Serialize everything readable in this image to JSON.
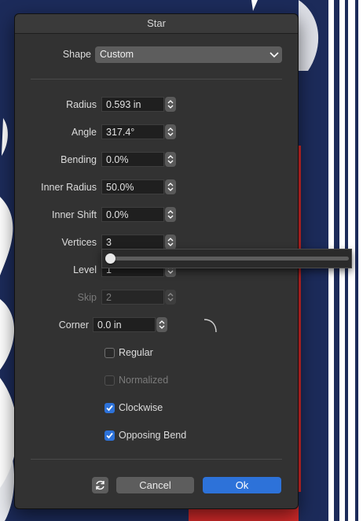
{
  "window": {
    "title": "Star"
  },
  "shape": {
    "label": "Shape",
    "value": "Custom"
  },
  "fields": {
    "radius": {
      "label": "Radius",
      "value": "0.593 in"
    },
    "angle": {
      "label": "Angle",
      "value": "317.4°"
    },
    "bending": {
      "label": "Bending",
      "value": "0.0%"
    },
    "inner_radius": {
      "label": "Inner Radius",
      "value": "50.0%"
    },
    "inner_shift": {
      "label": "Inner Shift",
      "value": "0.0%"
    },
    "vertices": {
      "label": "Vertices",
      "value": "3"
    },
    "level": {
      "label": "Level",
      "value": "1"
    },
    "skip": {
      "label": "Skip",
      "value": "2",
      "disabled": true
    },
    "corner": {
      "label": "Corner",
      "value": "0.0 in"
    }
  },
  "checkboxes": {
    "regular": {
      "label": "Regular",
      "checked": false
    },
    "normalized": {
      "label": "Normalized",
      "checked": false,
      "disabled": true
    },
    "clockwise": {
      "label": "Clockwise",
      "checked": true
    },
    "opposing_bend": {
      "label": "Opposing Bend",
      "checked": true
    }
  },
  "vertices_slider": {
    "value": 3
  },
  "buttons": {
    "cancel": "Cancel",
    "ok": "Ok"
  },
  "colors": {
    "accent": "#2d72d9",
    "background_art": "#1c2b5a",
    "red_accent": "#d42a2a"
  },
  "icons": {
    "reset": "reset-icon",
    "corner_preview": "corner-arc-icon",
    "dropdown": "chevron-down-icon"
  }
}
